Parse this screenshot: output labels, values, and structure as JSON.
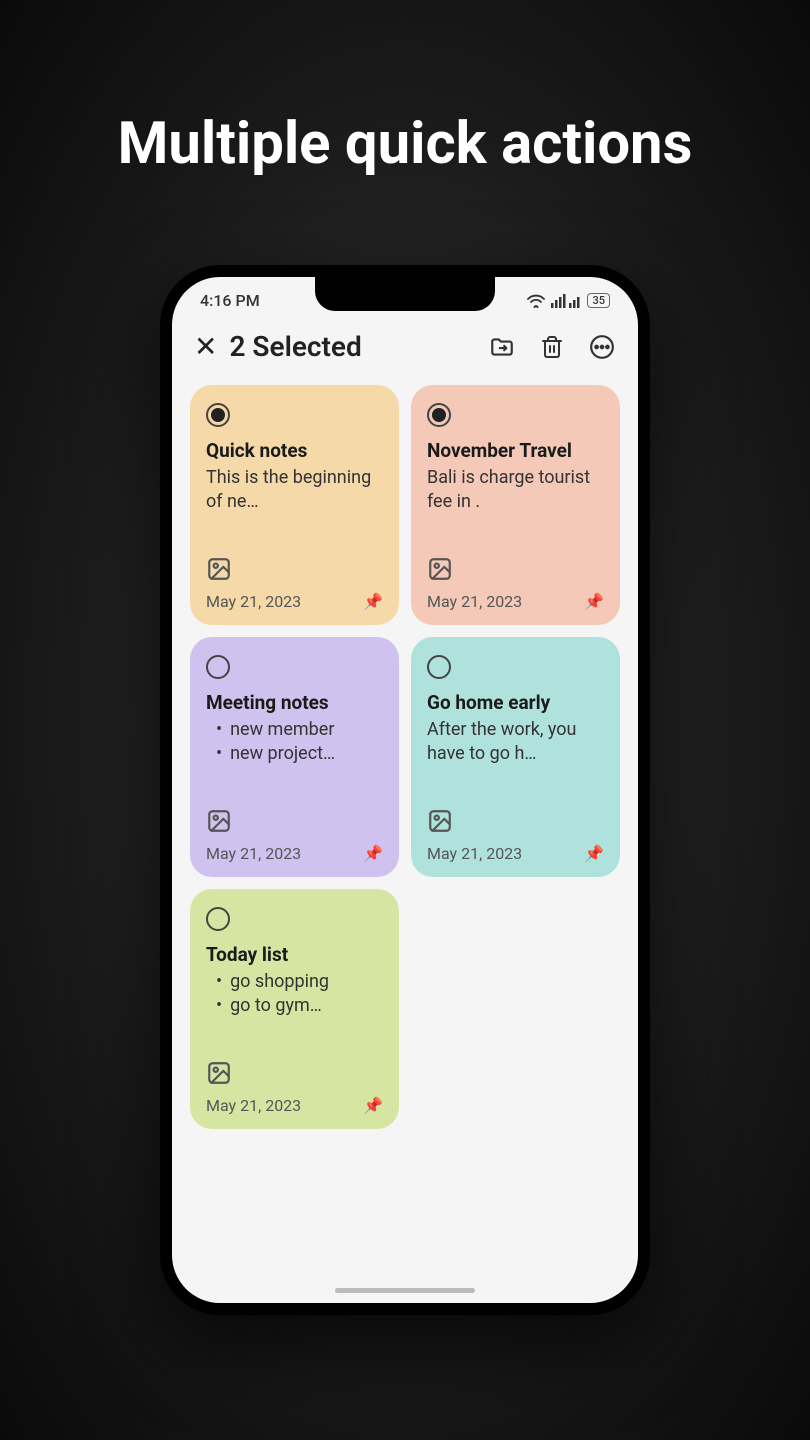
{
  "headline": "Multiple quick actions",
  "status": {
    "time": "4:16 PM",
    "battery": "35"
  },
  "header": {
    "title": "2 Selected"
  },
  "notes": [
    {
      "title": "Quick notes",
      "body": "This is the beginning of ne…",
      "date": "May 21, 2023",
      "color": "c-orange",
      "selected": true,
      "pinned": true,
      "hasImage": true,
      "bullets": null
    },
    {
      "title": "November Travel",
      "body": "Bali is charge tourist fee in .",
      "date": "May 21, 2023",
      "color": "c-peach",
      "selected": true,
      "pinned": true,
      "hasImage": true,
      "bullets": null
    },
    {
      "title": "Meeting notes",
      "body": null,
      "date": "May 21, 2023",
      "color": "c-purple",
      "selected": false,
      "pinned": true,
      "hasImage": true,
      "bullets": [
        "new member",
        "new project…"
      ]
    },
    {
      "title": "Go home early",
      "body": "After the work, you have to go h…",
      "date": "May 21, 2023",
      "color": "c-teal",
      "selected": false,
      "pinned": true,
      "hasImage": true,
      "bullets": null
    },
    {
      "title": "Today list",
      "body": null,
      "date": "May 21, 2023",
      "color": "c-green",
      "selected": false,
      "pinned": true,
      "hasImage": true,
      "bullets": [
        "go shopping",
        "go to gym…"
      ]
    }
  ]
}
